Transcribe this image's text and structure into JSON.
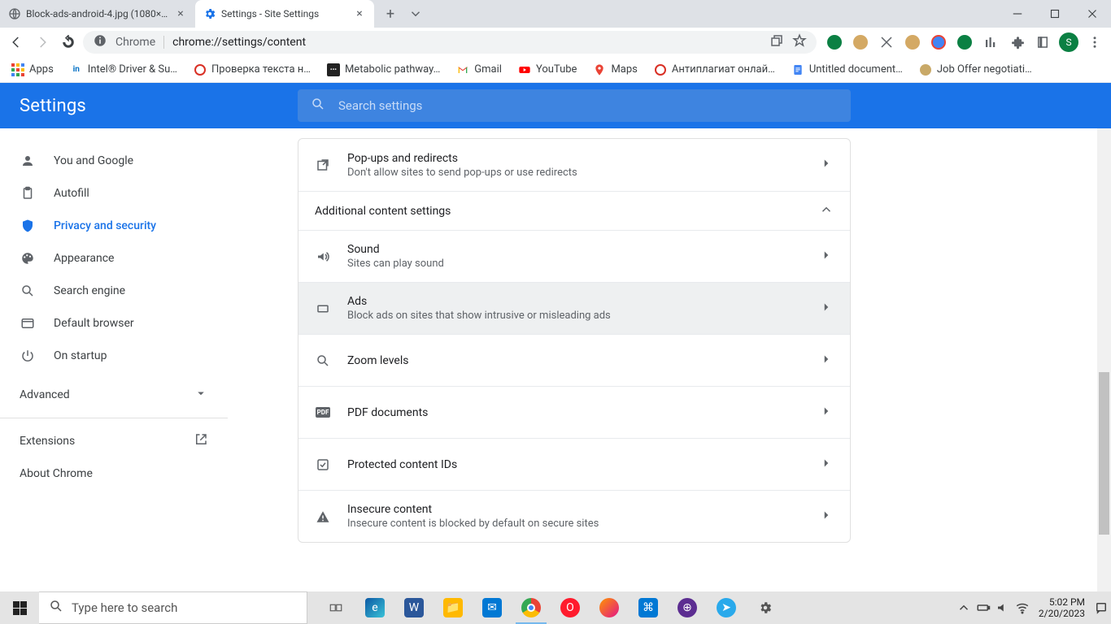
{
  "tabs": [
    {
      "title": "Block-ads-android-4.jpg (1080×2…",
      "favicon": "globe"
    },
    {
      "title": "Settings - Site Settings",
      "favicon": "gear-blue"
    }
  ],
  "omnibox": {
    "origin": "Chrome",
    "url": "chrome://settings/content"
  },
  "avatar_initial": "S",
  "bookmarks": [
    {
      "label": "Apps",
      "icon": "apps"
    },
    {
      "label": "Intel® Driver & Su…",
      "icon": "intel"
    },
    {
      "label": "Проверка текста н…",
      "icon": "red-c"
    },
    {
      "label": "Metabolic pathway…",
      "icon": "dots"
    },
    {
      "label": "Gmail",
      "icon": "gmail"
    },
    {
      "label": "YouTube",
      "icon": "youtube"
    },
    {
      "label": "Maps",
      "icon": "maps"
    },
    {
      "label": "Антиплагиат онлай…",
      "icon": "red-c"
    },
    {
      "label": "Untitled document…",
      "icon": "docs"
    },
    {
      "label": "Job Offer negotiati…",
      "icon": "tan"
    }
  ],
  "header": {
    "title": "Settings",
    "search_placeholder": "Search settings"
  },
  "sidebar": {
    "items": [
      {
        "label": "You and Google",
        "icon": "person"
      },
      {
        "label": "Autofill",
        "icon": "clipboard"
      },
      {
        "label": "Privacy and security",
        "icon": "shield",
        "active": true
      },
      {
        "label": "Appearance",
        "icon": "palette"
      },
      {
        "label": "Search engine",
        "icon": "search"
      },
      {
        "label": "Default browser",
        "icon": "browser"
      },
      {
        "label": "On startup",
        "icon": "power"
      }
    ],
    "advanced": "Advanced",
    "links": [
      {
        "label": "Extensions",
        "ext": true
      },
      {
        "label": "About Chrome"
      }
    ]
  },
  "settings": {
    "popups": {
      "title": "Pop-ups and redirects",
      "desc": "Don't allow sites to send pop-ups or use redirects"
    },
    "additional_header": "Additional content settings",
    "sound": {
      "title": "Sound",
      "desc": "Sites can play sound"
    },
    "ads": {
      "title": "Ads",
      "desc": "Block ads on sites that show intrusive or misleading ads"
    },
    "zoom": {
      "title": "Zoom levels"
    },
    "pdf": {
      "title": "PDF documents"
    },
    "protected": {
      "title": "Protected content IDs"
    },
    "insecure": {
      "title": "Insecure content",
      "desc": "Insecure content is blocked by default on secure sites"
    }
  },
  "taskbar": {
    "search_placeholder": "Type here to search",
    "time": "5:02 PM",
    "date": "2/20/2023"
  }
}
